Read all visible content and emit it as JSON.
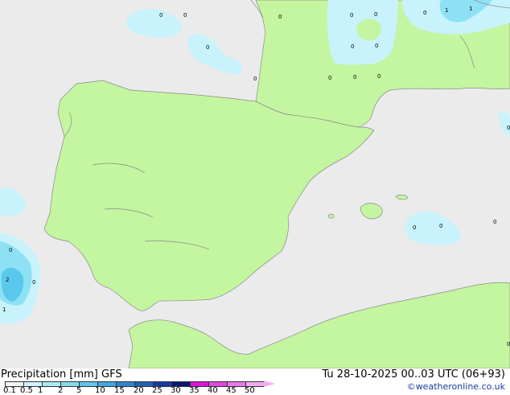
{
  "map": {
    "colors": {
      "sea": "#ebebeb",
      "land": "#c4f5a0",
      "precip_light": "#c8f3fc",
      "precip_mid": "#8ee1f5",
      "precip_heavy": "#5ac8ec"
    },
    "point_values": [
      "0",
      "0",
      "0",
      "0",
      "0",
      "1",
      "1",
      "0",
      "0",
      "0",
      "0",
      "0",
      "0",
      "0",
      "0",
      "0",
      "0",
      "0",
      "0",
      "0",
      "0",
      "2",
      "0",
      "1"
    ]
  },
  "footer": {
    "title": "Precipitation [mm]  GFS",
    "datetime": "Tu 28-10-2025 00..03 UTC (06+93)",
    "credit": "©weatheronline.co.uk"
  },
  "legend": {
    "labels": [
      "0.1",
      "0.5",
      "1",
      "2",
      "5",
      "10",
      "15",
      "20",
      "25",
      "30",
      "35",
      "40",
      "45",
      "50"
    ],
    "colors": [
      "#f5f5f5",
      "#cdf5fa",
      "#a5ebf5",
      "#82dcf0",
      "#5ac8eb",
      "#3caade",
      "#2d87cd",
      "#2064b9",
      "#143ca0",
      "#0a1478",
      "#dc14dc",
      "#e646e6",
      "#eb78eb",
      "#f0aaf0"
    ]
  }
}
